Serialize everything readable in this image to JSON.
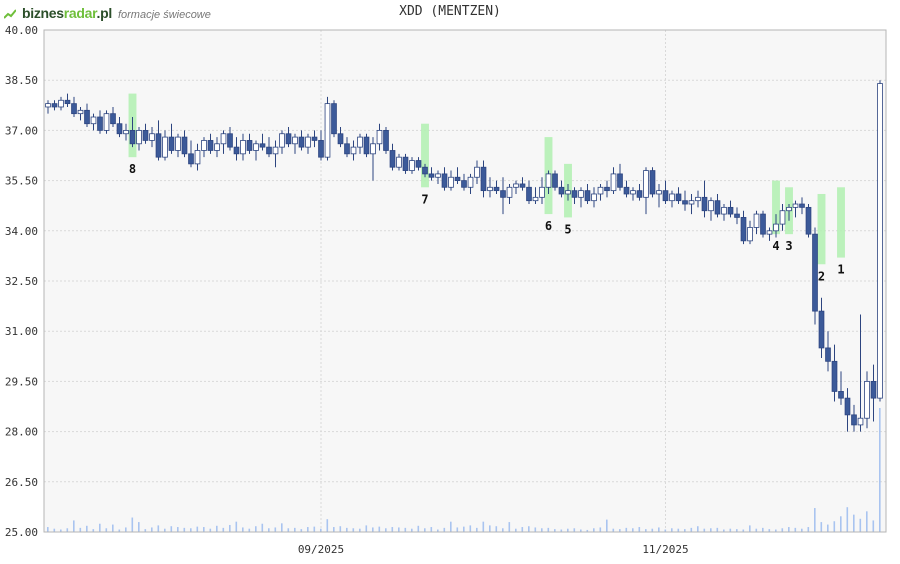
{
  "brand": {
    "name_part1": "biznes",
    "name_part2": "radar",
    "name_part3": ".pl",
    "subtitle": "formacje świecowe"
  },
  "colors": {
    "background": "#f7f7f7",
    "grid": "#d9d9d9",
    "up_candle": "#ffffff",
    "down_candle": "#3c5a99",
    "candle_border": "#2d4580",
    "volume": "#a9c4f0",
    "highlight": "#b4f0b4"
  },
  "chart_data": {
    "type": "candlestick",
    "title": "XDD (MENTZEN)",
    "ylim": [
      25,
      40
    ],
    "yticks": [
      "40.00",
      "38.50",
      "37.00",
      "35.50",
      "34.00",
      "32.50",
      "31.00",
      "29.50",
      "28.00",
      "26.50",
      "25.00"
    ],
    "ytick_values": [
      40,
      38.5,
      37,
      35.5,
      34,
      32.5,
      31,
      29.5,
      28,
      26.5,
      25
    ],
    "xticks": [
      {
        "label": "09/2025",
        "index": 42
      },
      {
        "label": "11/2025",
        "index": 95
      }
    ],
    "grid": true,
    "candles": [
      [
        37.7,
        37.9,
        37.5,
        37.8
      ],
      [
        37.8,
        37.9,
        37.6,
        37.7
      ],
      [
        37.7,
        38.0,
        37.6,
        37.9
      ],
      [
        37.9,
        38.1,
        37.7,
        37.8
      ],
      [
        37.8,
        38.0,
        37.4,
        37.5
      ],
      [
        37.5,
        37.7,
        37.3,
        37.6
      ],
      [
        37.6,
        37.8,
        37.1,
        37.2
      ],
      [
        37.2,
        37.5,
        37.0,
        37.4
      ],
      [
        37.4,
        37.6,
        36.9,
        37.0
      ],
      [
        37.0,
        37.6,
        36.9,
        37.5
      ],
      [
        37.5,
        37.7,
        37.1,
        37.2
      ],
      [
        37.2,
        37.4,
        36.8,
        36.9
      ],
      [
        36.9,
        37.2,
        36.7,
        37.0
      ],
      [
        37.0,
        37.4,
        36.5,
        36.6
      ],
      [
        36.6,
        37.1,
        36.4,
        37.0
      ],
      [
        37.0,
        37.2,
        36.6,
        36.7
      ],
      [
        36.7,
        37.1,
        36.5,
        36.9
      ],
      [
        36.9,
        37.3,
        36.1,
        36.2
      ],
      [
        36.2,
        37.0,
        36.1,
        36.8
      ],
      [
        36.8,
        37.2,
        36.3,
        36.4
      ],
      [
        36.4,
        36.9,
        36.2,
        36.8
      ],
      [
        36.8,
        37.0,
        36.2,
        36.3
      ],
      [
        36.3,
        36.7,
        35.9,
        36.0
      ],
      [
        36.0,
        36.6,
        35.8,
        36.4
      ],
      [
        36.4,
        36.8,
        36.2,
        36.7
      ],
      [
        36.7,
        36.9,
        36.3,
        36.4
      ],
      [
        36.4,
        36.8,
        36.2,
        36.6
      ],
      [
        36.6,
        37.0,
        36.3,
        36.9
      ],
      [
        36.9,
        37.1,
        36.4,
        36.5
      ],
      [
        36.5,
        36.8,
        36.1,
        36.3
      ],
      [
        36.3,
        36.9,
        36.1,
        36.7
      ],
      [
        36.7,
        36.9,
        36.3,
        36.4
      ],
      [
        36.4,
        36.7,
        36.1,
        36.6
      ],
      [
        36.6,
        36.9,
        36.4,
        36.5
      ],
      [
        36.5,
        36.8,
        36.2,
        36.3
      ],
      [
        36.3,
        36.7,
        35.9,
        36.5
      ],
      [
        36.5,
        37.0,
        36.3,
        36.9
      ],
      [
        36.9,
        37.1,
        36.5,
        36.6
      ],
      [
        36.6,
        36.9,
        36.3,
        36.8
      ],
      [
        36.8,
        37.0,
        36.4,
        36.5
      ],
      [
        36.5,
        36.9,
        36.3,
        36.8
      ],
      [
        36.8,
        37.0,
        36.5,
        36.7
      ],
      [
        36.7,
        37.0,
        36.1,
        36.2
      ],
      [
        36.2,
        38.0,
        36.1,
        37.8
      ],
      [
        37.8,
        37.9,
        36.8,
        36.9
      ],
      [
        36.9,
        37.1,
        36.5,
        36.6
      ],
      [
        36.6,
        36.8,
        36.2,
        36.3
      ],
      [
        36.3,
        36.7,
        36.1,
        36.5
      ],
      [
        36.5,
        36.9,
        36.3,
        36.8
      ],
      [
        36.8,
        36.9,
        36.2,
        36.3
      ],
      [
        36.3,
        36.8,
        35.5,
        36.6
      ],
      [
        36.6,
        37.2,
        36.4,
        37.0
      ],
      [
        37.0,
        37.1,
        36.3,
        36.4
      ],
      [
        36.4,
        36.6,
        35.8,
        35.9
      ],
      [
        35.9,
        36.3,
        35.8,
        36.2
      ],
      [
        36.2,
        36.3,
        35.7,
        35.8
      ],
      [
        35.8,
        36.2,
        35.7,
        36.1
      ],
      [
        36.1,
        36.2,
        35.8,
        35.9
      ],
      [
        35.9,
        36.0,
        35.6,
        35.7
      ],
      [
        35.7,
        35.9,
        35.5,
        35.6
      ],
      [
        35.6,
        35.8,
        35.4,
        35.7
      ],
      [
        35.7,
        35.9,
        35.2,
        35.3
      ],
      [
        35.3,
        35.8,
        35.2,
        35.6
      ],
      [
        35.6,
        35.9,
        35.4,
        35.5
      ],
      [
        35.5,
        35.7,
        35.2,
        35.3
      ],
      [
        35.3,
        35.7,
        35.1,
        35.6
      ],
      [
        35.6,
        36.1,
        35.4,
        35.9
      ],
      [
        35.9,
        36.1,
        35.0,
        35.2
      ],
      [
        35.2,
        35.6,
        35.0,
        35.3
      ],
      [
        35.3,
        35.5,
        35.1,
        35.2
      ],
      [
        35.2,
        35.6,
        34.5,
        35.0
      ],
      [
        35.0,
        35.4,
        34.8,
        35.3
      ],
      [
        35.3,
        35.5,
        35.1,
        35.4
      ],
      [
        35.4,
        35.6,
        35.2,
        35.3
      ],
      [
        35.3,
        35.5,
        34.8,
        34.9
      ],
      [
        34.9,
        35.3,
        34.8,
        35.0
      ],
      [
        35.0,
        35.6,
        34.8,
        35.3
      ],
      [
        35.3,
        35.8,
        35.1,
        35.7
      ],
      [
        35.7,
        35.8,
        35.2,
        35.3
      ],
      [
        35.3,
        35.5,
        35.0,
        35.1
      ],
      [
        35.1,
        35.4,
        34.9,
        35.2
      ],
      [
        35.2,
        35.3,
        34.8,
        35.0
      ],
      [
        35.0,
        35.3,
        34.7,
        35.2
      ],
      [
        35.2,
        35.4,
        34.8,
        34.9
      ],
      [
        34.9,
        35.3,
        34.7,
        35.1
      ],
      [
        35.1,
        35.4,
        34.9,
        35.3
      ],
      [
        35.3,
        35.5,
        35.0,
        35.2
      ],
      [
        35.2,
        35.9,
        35.1,
        35.7
      ],
      [
        35.7,
        36.0,
        35.2,
        35.3
      ],
      [
        35.3,
        35.5,
        35.0,
        35.1
      ],
      [
        35.1,
        35.3,
        34.9,
        35.2
      ],
      [
        35.2,
        35.4,
        34.9,
        35.0
      ],
      [
        35.0,
        35.9,
        34.5,
        35.8
      ],
      [
        35.8,
        35.9,
        35.0,
        35.1
      ],
      [
        35.1,
        35.4,
        34.7,
        35.2
      ],
      [
        35.2,
        35.5,
        34.8,
        34.9
      ],
      [
        34.9,
        35.2,
        34.7,
        35.1
      ],
      [
        35.1,
        35.3,
        34.8,
        34.9
      ],
      [
        34.9,
        35.2,
        34.6,
        34.8
      ],
      [
        34.8,
        35.1,
        34.5,
        34.9
      ],
      [
        34.9,
        35.2,
        34.7,
        35.0
      ],
      [
        35.0,
        35.5,
        34.4,
        34.6
      ],
      [
        34.6,
        35.0,
        34.3,
        34.9
      ],
      [
        34.9,
        35.1,
        34.4,
        34.5
      ],
      [
        34.5,
        34.8,
        34.3,
        34.7
      ],
      [
        34.7,
        34.9,
        34.4,
        34.5
      ],
      [
        34.5,
        34.7,
        34.2,
        34.4
      ],
      [
        34.4,
        34.6,
        33.6,
        33.7
      ],
      [
        33.7,
        34.3,
        33.6,
        34.1
      ],
      [
        34.1,
        34.6,
        33.9,
        34.5
      ],
      [
        34.5,
        34.6,
        33.8,
        33.9
      ],
      [
        33.9,
        34.1,
        33.7,
        34.0
      ],
      [
        34.0,
        34.5,
        33.8,
        34.2
      ],
      [
        34.2,
        34.8,
        34.0,
        34.6
      ],
      [
        34.6,
        34.8,
        34.3,
        34.7
      ],
      [
        34.7,
        34.9,
        34.4,
        34.8
      ],
      [
        34.8,
        35.0,
        34.5,
        34.7
      ],
      [
        34.7,
        34.8,
        33.8,
        33.9
      ],
      [
        33.9,
        34.1,
        31.2,
        31.6
      ],
      [
        31.6,
        32.0,
        30.2,
        30.5
      ],
      [
        30.5,
        31.0,
        29.8,
        30.1
      ],
      [
        30.1,
        30.6,
        28.9,
        29.2
      ],
      [
        29.2,
        29.8,
        28.8,
        29.0
      ],
      [
        29.0,
        29.3,
        28.0,
        28.5
      ],
      [
        28.5,
        28.8,
        28.0,
        28.2
      ],
      [
        28.2,
        31.5,
        28.0,
        28.4
      ],
      [
        28.4,
        29.8,
        28.1,
        29.5
      ],
      [
        29.5,
        30.0,
        28.3,
        29.0
      ],
      [
        29.0,
        38.5,
        28.9,
        38.4
      ]
    ],
    "volumes": [
      1.2,
      0.8,
      0.6,
      0.9,
      2.8,
      1.0,
      1.5,
      0.7,
      2.0,
      0.9,
      1.8,
      0.6,
      1.1,
      3.5,
      2.4,
      0.7,
      1.1,
      1.6,
      0.8,
      1.4,
      1.2,
      1.0,
      0.9,
      1.3,
      1.2,
      0.8,
      1.5,
      1.0,
      1.7,
      2.5,
      1.1,
      0.8,
      1.4,
      2.0,
      0.9,
      1.1,
      2.1,
      0.9,
      1.0,
      0.7,
      1.2,
      1.3,
      0.8,
      3.1,
      1.2,
      1.4,
      1.0,
      0.9,
      0.8,
      1.6,
      1.1,
      1.3,
      0.9,
      1.2,
      1.1,
      1.0,
      0.8,
      1.5,
      0.9,
      1.2,
      0.6,
      1.0,
      2.5,
      1.1,
      1.3,
      1.6,
      1.0,
      2.5,
      1.6,
      1.4,
      0.9,
      2.4,
      0.8,
      1.2,
      1.4,
      1.1,
      0.9,
      1.0,
      0.7,
      0.6,
      0.8,
      0.9,
      0.6,
      0.5,
      0.9,
      1.1,
      3.0,
      0.8,
      0.7,
      1.0,
      0.9,
      1.2,
      0.7,
      0.8,
      1.1,
      0.6,
      0.9,
      0.8,
      0.7,
      1.0,
      1.4,
      0.8,
      0.9,
      1.0,
      0.6,
      0.8,
      0.7,
      0.6,
      1.6,
      0.8,
      1.0,
      0.7,
      0.6,
      0.9,
      1.2,
      1.0,
      0.8,
      1.2,
      5.8,
      2.4,
      1.8,
      2.6,
      3.8,
      6.0,
      4.2,
      3.2,
      5.0,
      2.8,
      30.0
    ],
    "patterns": [
      {
        "label": "8",
        "index": 13,
        "low": 36.2,
        "high": 38.1,
        "side": "below"
      },
      {
        "label": "7",
        "index": 58,
        "low": 35.3,
        "high": 37.2,
        "side": "below"
      },
      {
        "label": "6",
        "index": 77,
        "low": 34.5,
        "high": 36.8,
        "side": "below"
      },
      {
        "label": "5",
        "index": 80,
        "low": 34.4,
        "high": 36.0,
        "side": "below"
      },
      {
        "label": "4",
        "index": 112,
        "low": 33.9,
        "high": 35.5,
        "side": "below"
      },
      {
        "label": "3",
        "index": 114,
        "low": 33.9,
        "high": 35.3,
        "side": "below"
      },
      {
        "label": "2",
        "index": 119,
        "low": 33.0,
        "high": 35.1,
        "side": "below"
      },
      {
        "label": "1",
        "index": 122,
        "low": 33.2,
        "high": 35.3,
        "side": "below"
      }
    ]
  }
}
